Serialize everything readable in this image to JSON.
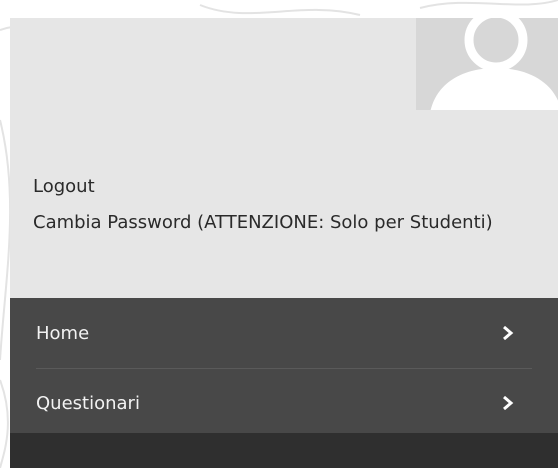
{
  "user": {
    "logout_label": "Logout",
    "change_password_label": "Cambia Password (ATTENZIONE: Solo per Studenti)"
  },
  "nav": {
    "items": [
      {
        "label": "Home"
      },
      {
        "label": "Questionari"
      }
    ]
  },
  "icons": {
    "avatar": "user-avatar-icon",
    "chevron": "chevron-right-icon"
  },
  "colors": {
    "panel_bg": "#e6e6e6",
    "nav_bg": "#484848",
    "nav_footer_bg": "#2f2f2f",
    "avatar_bg": "#d7d7d7",
    "avatar_fg": "#ffffff"
  }
}
